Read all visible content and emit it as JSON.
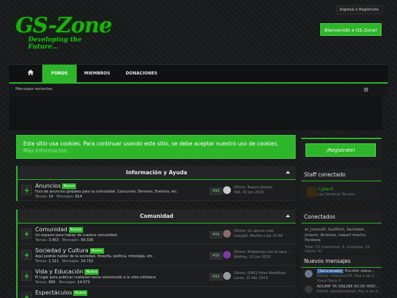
{
  "top": {
    "login_label": "Ingresá o Registrate"
  },
  "logo": {
    "main": "GS-Zone",
    "tagline": "Developing the Future..."
  },
  "welcome_label": "Bienvenido a GS-Zone!",
  "nav": {
    "foros": "FOROS",
    "miembros": "MIEMBROS",
    "donaciones": "DONACIONES"
  },
  "subnav": {
    "recent": "Mensajes recientes"
  },
  "cookie": {
    "text": "Este sitio usa cookies. Para continuar usando este sitio, se debe aceptar nuestro uso de cookies.",
    "more": "Más Información."
  },
  "register_label": "¡Registrate!",
  "categories": [
    {
      "title": "Información y Ayuda",
      "forums": [
        {
          "name": "Anuncios",
          "badge": "Nuevo",
          "desc": "Foro de anuncios globales para la comunidad. Concursos, Torneros, Eventos, etc.",
          "temas_label": "Temas:",
          "temas": "14",
          "mensajes_label": "Mensajes:",
          "mensajes": "614",
          "rss": "RSS",
          "last1": "Último: Nuevo diseño!",
          "last2": "XIIII, 30 Jun 2019"
        }
      ]
    },
    {
      "title": "Comunidad",
      "forums": [
        {
          "name": "Comunidad",
          "badge": "Nuevo",
          "desc": "Un espacio para hablar de nuestra comunidad",
          "temas_label": "Temas:",
          "temas": "3.453",
          "mensajes_label": "Mensajes:",
          "mensajes": "59.338",
          "rss": "RSS",
          "last1": "Último: Un aporte más",
          "last2": "maxgoli, Martes a las 15:49"
        },
        {
          "name": "Sociedad y Cultura",
          "badge": "Nuevo",
          "desc": "Aquí podrás hablar de la sociedad, filosofía, política, mitología, etc.",
          "temas_label": "Temas:",
          "temas": "1.311",
          "mensajes_label": "Mensajes:",
          "mensajes": "24.710",
          "rss": "RSS",
          "last1": "Último: Problemas con la hora ...",
          "last2": "Wolfrey, 10 Jun 2019"
        },
        {
          "name": "Vida y Educación",
          "badge": "Nuevo",
          "desc": "El lugar para publicar cualquier tema relacionado a la vida cotidiana",
          "temas_label": "Temas:",
          "temas": "895",
          "mensajes_label": "Mensajes:",
          "mensajes": "14.573",
          "rss": "RSS",
          "last1": "Último: [SKK] Fotos WeeMoon",
          "last2": "Lucas, 23 Abr 2019"
        },
        {
          "name": "Espectáculos",
          "badge": "Nuevo",
          "desc": "",
          "temas_label": "",
          "temas": "",
          "mensajes_label": "",
          "mensajes": "",
          "rss": "",
          "last1": "",
          "last2": ""
        }
      ]
    }
  ],
  "sidebar": {
    "staff_title": "Staff conectado",
    "staff_name": "CyberX",
    "staff_role": "Los Sombras Técnico",
    "online_title": "Conectados",
    "online_users": "el_Lorenz9, GuillOch, Seniobdr, Jmoxm, Brolinex, kabarf macho, Pandora",
    "online_stats": "Total: 13 (miembros: 8, invitados: 13, robots: 5)",
    "news_title": "Nuevos mensajes",
    "news": [
      {
        "tag": "[Solucionado]",
        "title": "Escribir datos...",
        "meta": "Último: miquesa150, Hoy a las 2...",
        "forum": "Visual Basic 6"
      },
      {
        "tag": "",
        "title": "ADUMP YA ONLINE 00:00 HRS!...",
        "meta": "Último: davidsnowball, Hoy a las 2...",
        "forum": ""
      }
    ]
  },
  "colors": {
    "accent": "#2db62a",
    "background": "#1a1c1d"
  }
}
